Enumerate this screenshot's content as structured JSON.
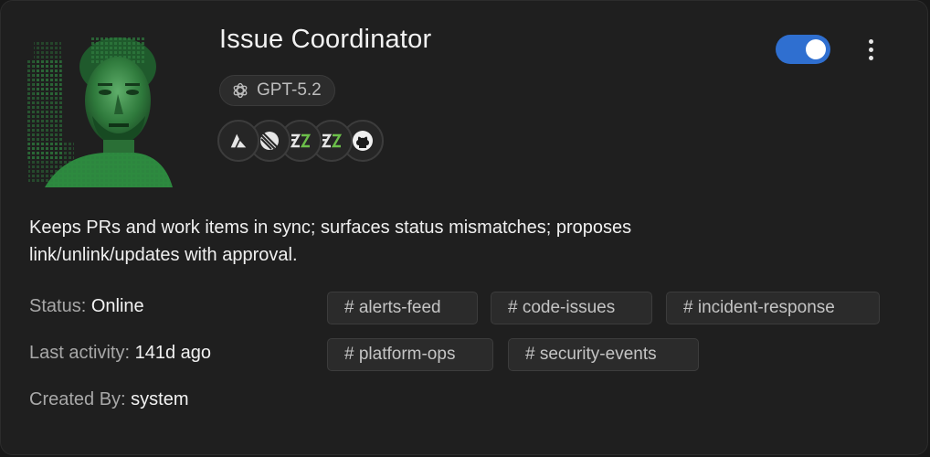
{
  "agent": {
    "name": "Issue Coordinator",
    "model": "GPT-5.2",
    "enabled": true,
    "description": "Keeps PRs and work items in sync; surfaces status mismatches; proposes link/unlink/updates with approval.",
    "integrations": [
      "azure-devops-icon",
      "linear-icon",
      "zapier-icon",
      "zapier-icon",
      "github-icon"
    ]
  },
  "meta": {
    "status_label": "Status:",
    "status_value": "Online",
    "activity_label": "Last activity:",
    "activity_value": "141d ago",
    "created_label": "Created By:",
    "created_value": "system"
  },
  "channels": [
    "# alerts-feed",
    "# code-issues",
    "# incident-response",
    "# platform-ops",
    "# security-events"
  ],
  "colors": {
    "toggle_on": "#2f6fd0",
    "avatar_tint": "#2e7d3e",
    "card_bg": "#1f1f1f"
  }
}
